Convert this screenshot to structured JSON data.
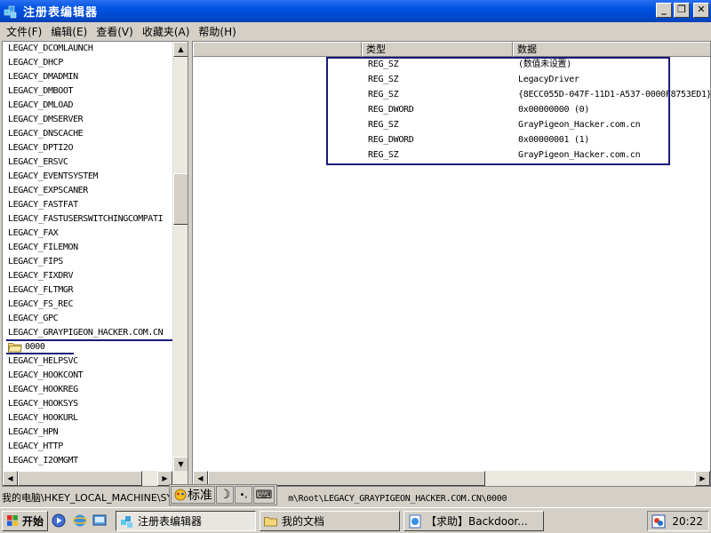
{
  "window": {
    "title": "注册表编辑器",
    "minimize": "_",
    "restore": "❐",
    "close": "✕"
  },
  "menu": [
    "文件(F)",
    "编辑(E)",
    "查看(V)",
    "收藏夹(A)",
    "帮助(H)"
  ],
  "tree": {
    "items": [
      "LEGACY_DCOMLAUNCH",
      "LEGACY_DHCP",
      "LEGACY_DMADMIN",
      "LEGACY_DMBOOT",
      "LEGACY_DMLOAD",
      "LEGACY_DMSERVER",
      "LEGACY_DNSCACHE",
      "LEGACY_DPTI2O",
      "LEGACY_ERSVC",
      "LEGACY_EVENTSYSTEM",
      "LEGACY_EXPSCANER",
      "LEGACY_FASTFAT",
      "LEGACY_FASTUSERSWITCHINGCOMPATI",
      "LEGACY_FAX",
      "LEGACY_FILEMON",
      "LEGACY_FIPS",
      "LEGACY_FIXDRV",
      "LEGACY_FLTMGR",
      "LEGACY_FS_REC",
      "LEGACY_GPC",
      "LEGACY_GRAYPIGEON_HACKER.COM.CN",
      "0000",
      "LEGACY_HELPSVC",
      "LEGACY_HOOKCONT",
      "LEGACY_HOOKREG",
      "LEGACY_HOOKSYS",
      "LEGACY_HOOKURL",
      "LEGACY_HPN",
      "LEGACY_HTTP",
      "LEGACY_I2OMGMT"
    ]
  },
  "values": {
    "headers": {
      "name": "",
      "type": "类型",
      "data": "数据"
    },
    "rows": [
      {
        "type": "REG_SZ",
        "data": "(数值未设置)"
      },
      {
        "type": "REG_SZ",
        "data": "LegacyDriver"
      },
      {
        "type": "REG_SZ",
        "data": "{8ECC055D-047F-11D1-A537-0000F8753ED1}"
      },
      {
        "type": "REG_DWORD",
        "data": "0x00000000 (0)"
      },
      {
        "type": "REG_SZ",
        "data": "GrayPigeon_Hacker.com.cn"
      },
      {
        "type": "REG_DWORD",
        "data": "0x00000001 (1)"
      },
      {
        "type": "REG_SZ",
        "data": "GrayPigeon_Hacker.com.cn"
      }
    ]
  },
  "status": {
    "path_prefix": "我的电脑\\HKEY_LOCAL_MACHINE\\SYS",
    "path_suffix": "m\\Root\\LEGACY_GRAYPIGEON_HACKER.COM.CN\\0000"
  },
  "ime": {
    "mode": "标准",
    "moon": "☽",
    "punct": "•,",
    "keyboard": "⌨"
  },
  "taskbar": {
    "start": "开始",
    "tasks": [
      "注册表编辑器",
      "我的文档",
      "【求助】Backdoor..."
    ],
    "clock": "20:22"
  },
  "colors": {
    "titlebar": "#0052e0",
    "annotation": "#1a1a7a",
    "chrome": "#d4d0c8"
  }
}
